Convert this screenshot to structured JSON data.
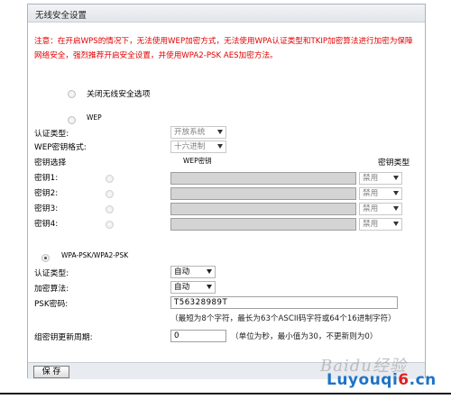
{
  "window": {
    "title": "无线安全设置"
  },
  "notice": "注意：在开启WPS的情况下，无法使用WEP加密方式，无法使用WPA认证类型和TKIP加密算法进行加密为保障网络安全，强烈推荐开启安全设置，并使用WPA2-PSK AES加密方法。",
  "options": {
    "disable_security": {
      "label": "关闭无线安全选项",
      "checked": false
    },
    "wep": {
      "label": "WEP",
      "checked": false,
      "auth_type_label": "认证类型:",
      "auth_type_value": "开放系统",
      "key_format_label": "WEP密钥格式:",
      "key_format_value": "十六进制",
      "col_key_select": "密钥选择",
      "col_wep_key": "WEP密钥",
      "col_key_type": "密钥类型",
      "keys": [
        {
          "label": "密钥1:",
          "type": "禁用"
        },
        {
          "label": "密钥2:",
          "type": "禁用"
        },
        {
          "label": "密钥3:",
          "type": "禁用"
        },
        {
          "label": "密钥4:",
          "type": "禁用"
        }
      ]
    },
    "wpa": {
      "label": "WPA-PSK/WPA2-PSK",
      "checked": true,
      "auth_type_label": "认证类型:",
      "auth_type_value": "自动",
      "encryption_label": "加密算法:",
      "encryption_value": "自动",
      "psk_label": "PSK密码:",
      "psk_value": "T56328989T",
      "psk_hint": "（最短为8个字符，最长为63个ASCII码字符或64个16进制字符）",
      "rekey_label": "组密钥更新周期:",
      "rekey_value": "0",
      "rekey_hint": "（单位为秒，最小值为30，不更新则为0）"
    }
  },
  "footer": {
    "save_label": "保 存"
  },
  "watermark": {
    "top": "Baidu经验",
    "bottom_a": "Luyouqi",
    "bottom_b": "6",
    "bottom_c": ".cn"
  }
}
